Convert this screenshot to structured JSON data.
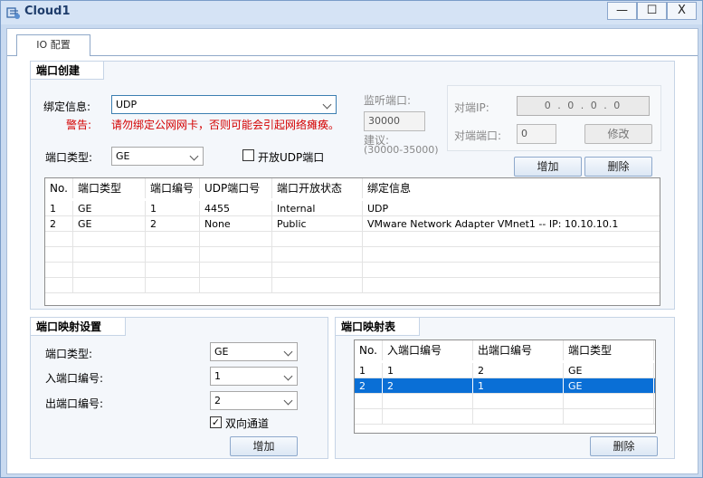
{
  "window": {
    "title": "Cloud1",
    "min_glyph": "—",
    "max_glyph": "☐",
    "close_glyph": "X"
  },
  "tabs": [
    {
      "label": "IO 配置"
    }
  ],
  "port_create": {
    "section_title": "端口创建",
    "bind_label": "绑定信息:",
    "bind_value": "UDP",
    "warning_label": "警告:",
    "warning_text": "请勿绑定公网网卡，否则可能会引起网络瘫痪。",
    "port_type_label": "端口类型:",
    "port_type_value": "GE",
    "open_udp_label": "开放UDP端口",
    "open_udp_checked": false,
    "listen_port_label": "监听端口:",
    "listen_port_value": "30000",
    "suggest_label": "建议:",
    "suggest_range": "(30000-35000)",
    "peer_ip_label": "对端IP:",
    "peer_ip_value": "0 . 0 . 0 . 0",
    "peer_port_label": "对端端口:",
    "peer_port_value": "0",
    "modify_button": "修改",
    "add_button": "增加",
    "delete_button": "删除",
    "table": {
      "columns": [
        "No.",
        "端口类型",
        "端口编号",
        "UDP端口号",
        "端口开放状态",
        "绑定信息"
      ],
      "rows": [
        [
          "1",
          "GE",
          "1",
          "4455",
          "Internal",
          "UDP"
        ],
        [
          "2",
          "GE",
          "2",
          "None",
          "Public",
          "VMware Network Adapter VMnet1 -- IP: 10.10.10.1"
        ]
      ]
    }
  },
  "port_map_settings": {
    "section_title": "端口映射设置",
    "port_type_label": "端口类型:",
    "port_type_value": "GE",
    "in_port_label": "入端口编号:",
    "in_port_value": "1",
    "out_port_label": "出端口编号:",
    "out_port_value": "2",
    "bidirectional_label": "双向通道",
    "bidirectional_checked": true,
    "add_button": "增加"
  },
  "port_map_table": {
    "section_title": "端口映射表",
    "columns": [
      "No.",
      "入端口编号",
      "出端口编号",
      "端口类型"
    ],
    "rows": [
      [
        "1",
        "1",
        "2",
        "GE"
      ],
      [
        "2",
        "2",
        "1",
        "GE"
      ]
    ],
    "selected_row": 2,
    "delete_button": "删除"
  },
  "colors": {
    "selection": "#0a6fd6",
    "warning": "#d40000",
    "title": "#1f3d6b"
  }
}
